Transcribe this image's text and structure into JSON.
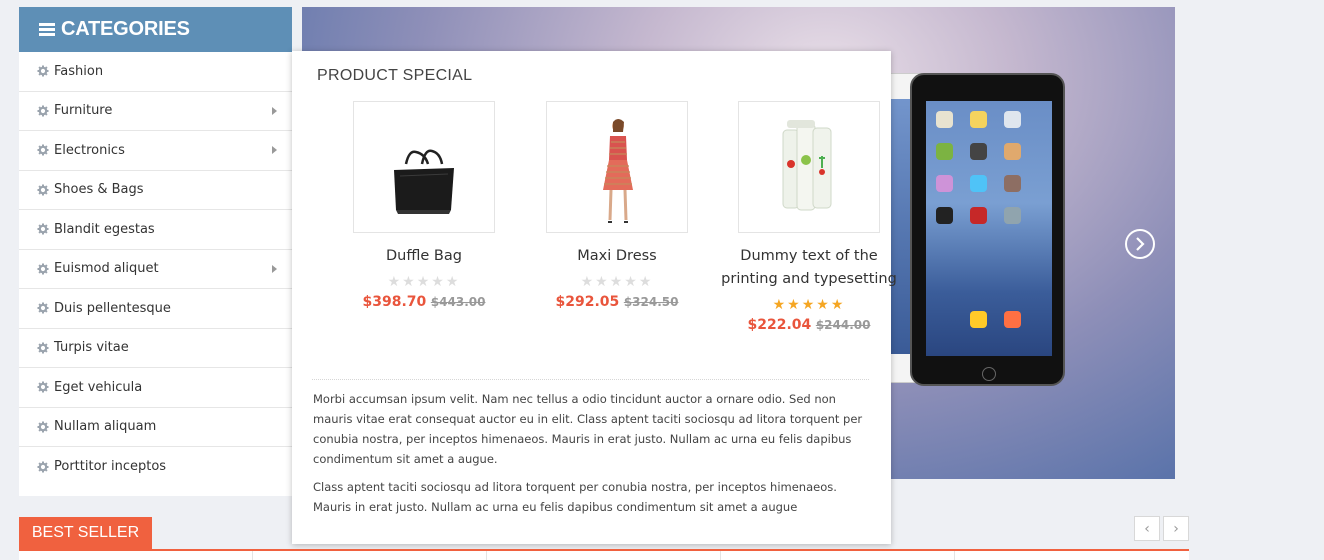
{
  "sidebar": {
    "title": "CATEGORIES",
    "items": [
      {
        "label": "Fashion",
        "has_submenu": false
      },
      {
        "label": "Furniture",
        "has_submenu": true
      },
      {
        "label": "Electronics",
        "has_submenu": true
      },
      {
        "label": "Shoes & Bags",
        "has_submenu": false
      },
      {
        "label": "Blandit egestas",
        "has_submenu": false
      },
      {
        "label": "Euismod aliquet",
        "has_submenu": true
      },
      {
        "label": "Duis pellentesque",
        "has_submenu": false
      },
      {
        "label": "Turpis vitae",
        "has_submenu": false
      },
      {
        "label": "Eget vehicula",
        "has_submenu": false
      },
      {
        "label": "Nullam aliquam",
        "has_submenu": false
      },
      {
        "label": "Porttitor inceptos",
        "has_submenu": false
      }
    ]
  },
  "special": {
    "title": "PRODUCT SPECIAL",
    "products": [
      {
        "name": "Duffle Bag",
        "price": "$398.70",
        "old_price": "$443.00",
        "rating": 0
      },
      {
        "name": "Maxi Dress",
        "price": "$292.05",
        "old_price": "$324.50",
        "rating": 0
      },
      {
        "name": "Dummy text of the printing and typesetting",
        "price": "$222.04",
        "old_price": "$244.00",
        "rating": 5
      }
    ],
    "paragraphs": [
      "Morbi accumsan ipsum velit. Nam nec tellus a odio tincidunt auctor a ornare odio. Sed non mauris vitae erat consequat auctor eu in elit. Class aptent taciti sociosqu ad litora torquent per conubia nostra, per inceptos himenaeos. Mauris in erat justo. Nullam ac urna eu felis dapibus condimentum sit amet a augue.",
      "Class aptent taciti sociosqu ad litora torquent per conubia nostra, per inceptos himenaeos. Mauris in erat justo. Nullam ac urna eu felis dapibus condimentum sit amet a augue"
    ]
  },
  "best_seller": {
    "label": "BEST SELLER",
    "prev": "‹",
    "next": "›"
  },
  "colors": {
    "sidebar_header": "#5e8fb6",
    "accent": "#f0613f",
    "price": "#e9553c",
    "star_on": "#f5a623",
    "star_off": "#dddddd"
  }
}
